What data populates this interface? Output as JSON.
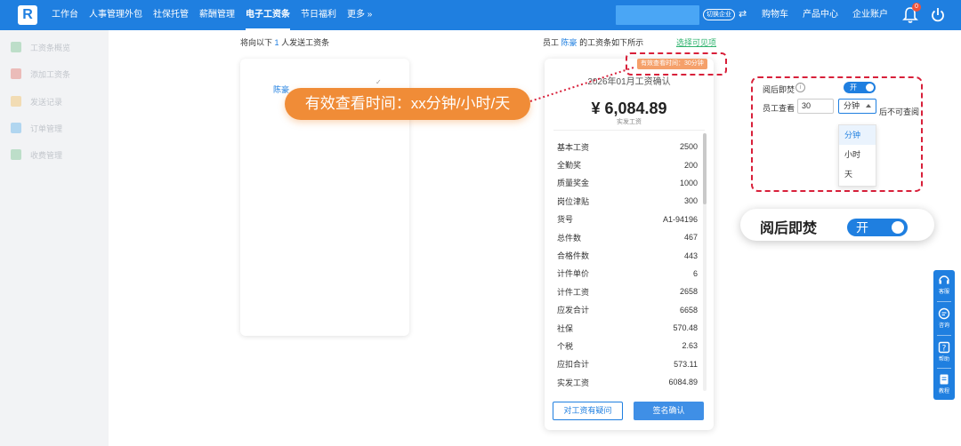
{
  "brand": {
    "logo_letter": "R"
  },
  "nav": {
    "items": [
      "工作台",
      "人事管理外包",
      "社保托管",
      "薪酬管理",
      "电子工资条",
      "节日福利",
      "更多 »"
    ],
    "active_index": 4
  },
  "header": {
    "switch_label": "切换企业",
    "cart": "购物车",
    "products": "产品中心",
    "account": "企业账户",
    "notification_count": "0"
  },
  "sidebar": {
    "items": [
      "工资条概览",
      "添加工资条",
      "发送记录",
      "订单管理",
      "收费管理"
    ]
  },
  "left_panel": {
    "tip_prefix": "将向以下",
    "tip_count": "1",
    "tip_suffix": "人发送工资条",
    "employee_name": "陈豪"
  },
  "preview": {
    "title_prefix": "员工",
    "employee": "陈豪",
    "title_suffix": "的工资条如下所示",
    "select_link": "选择可见项",
    "valid_badge": "有效查看时间：30分钟",
    "slip_title": "2026年01月工资确认",
    "amount": "¥ 6,084.89",
    "amount_label": "实发工资",
    "rows": [
      {
        "label": "基本工资",
        "value": "2500"
      },
      {
        "label": "全勤奖",
        "value": "200"
      },
      {
        "label": "质量奖金",
        "value": "1000"
      },
      {
        "label": "岗位津贴",
        "value": "300"
      },
      {
        "label": "货号",
        "value": "A1-94196"
      },
      {
        "label": "总件数",
        "value": "467"
      },
      {
        "label": "合格件数",
        "value": "443"
      },
      {
        "label": "计件单价",
        "value": "6"
      },
      {
        "label": "计件工资",
        "value": "2658"
      },
      {
        "label": "应发合计",
        "value": "6658"
      },
      {
        "label": "社保",
        "value": "570.48"
      },
      {
        "label": "个税",
        "value": "2.63"
      },
      {
        "label": "应扣合计",
        "value": "573.11"
      },
      {
        "label": "实发工资",
        "value": "6084.89"
      }
    ],
    "btn_question": "对工资有疑问",
    "btn_confirm": "签名确认"
  },
  "callout": {
    "text": "有效查看时间：xx分钟/小时/天"
  },
  "settings": {
    "burn_label": "阅后即焚",
    "toggle_on": "开",
    "view_label": "员工查看",
    "view_value": "30",
    "unit_selected": "分钟",
    "after_label": "后不可查阅",
    "unit_options": [
      "分钟",
      "小时",
      "天"
    ]
  },
  "burn_pill": {
    "label": "阅后即焚",
    "toggle_on": "开"
  },
  "rail": {
    "items": [
      "客服",
      "咨询",
      "帮助",
      "教程"
    ]
  },
  "colors": {
    "primary": "#1f7fe0",
    "callout": "#f08c37",
    "highlight_dash": "#d8203a"
  }
}
